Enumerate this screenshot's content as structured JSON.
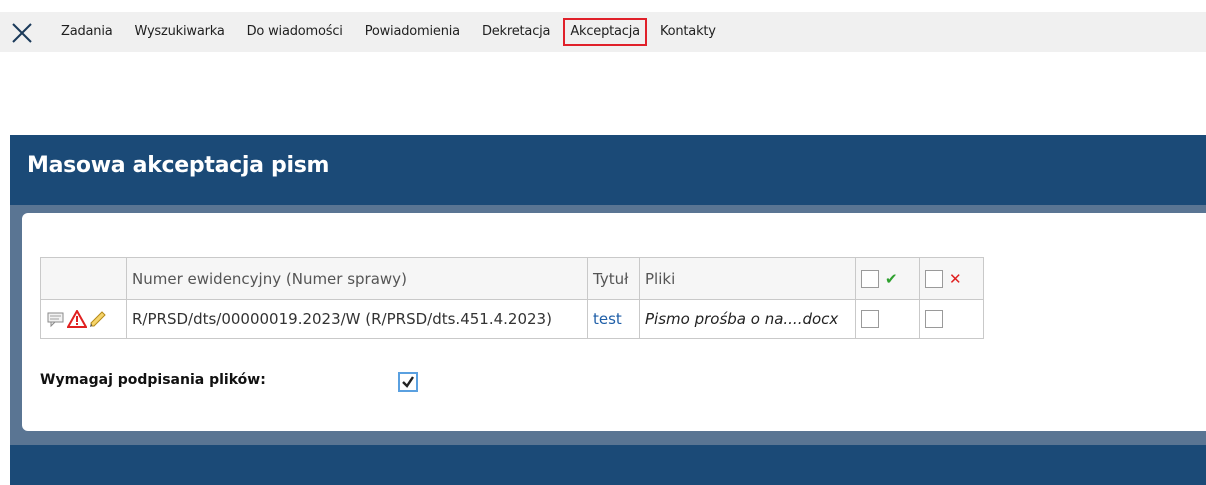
{
  "nav": {
    "items": [
      {
        "label": "Zadania"
      },
      {
        "label": "Wyszukiwarka"
      },
      {
        "label": "Do wiadomości"
      },
      {
        "label": "Powiadomienia"
      },
      {
        "label": "Dekretacja"
      },
      {
        "label": "Akceptacja",
        "active": true
      },
      {
        "label": "Kontakty"
      }
    ]
  },
  "panel": {
    "title": "Masowa akceptacja pism"
  },
  "table": {
    "headers": {
      "icons": "",
      "number": "Numer ewidencyjny (Numer sprawy)",
      "title": "Tytuł",
      "files": "Pliki"
    },
    "rows": [
      {
        "number": "R/PRSD/dts/00000019.2023/W (R/PRSD/dts.451.4.2023)",
        "title": "test",
        "files": "Pismo prośba o na....docx",
        "accept_checked": false,
        "reject_checked": false
      }
    ]
  },
  "require_signing": {
    "label": "Wymagaj podpisania plików:",
    "checked": true
  },
  "colors": {
    "panel_bg": "#1b4a77",
    "stripe": "#5a7593",
    "active_outline": "#e0202a",
    "link": "#1f5fa8",
    "accept": "#2ea02e",
    "reject": "#e02020"
  },
  "icons": [
    "close-icon",
    "comment-icon",
    "warning-icon",
    "pencil-icon",
    "check-icon",
    "x-icon"
  ]
}
